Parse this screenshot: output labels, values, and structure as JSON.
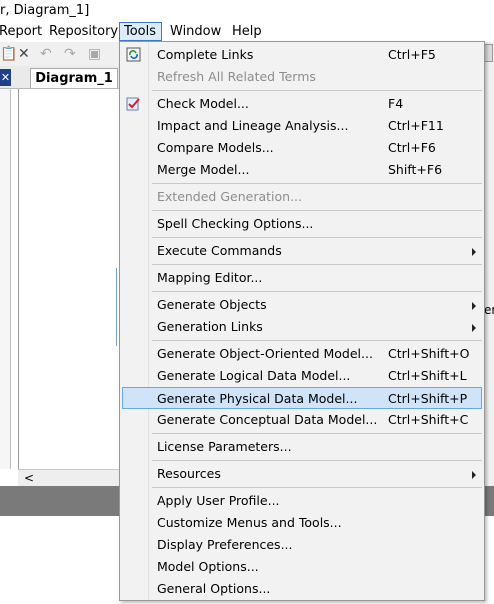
{
  "window": {
    "title_fragment": "r, Diagram_1]"
  },
  "menubar": {
    "report": "Report",
    "repository": "Repository",
    "tools": "Tools",
    "window": "Window",
    "help": "Help"
  },
  "document_tab": {
    "label": "Diagram_1"
  },
  "right_edge_text": "er",
  "tools_menu": {
    "complete_links": {
      "label": "Complete Links",
      "shortcut": "Ctrl+F5"
    },
    "refresh_terms": {
      "label": "Refresh All Related Terms",
      "shortcut": ""
    },
    "check_model": {
      "label": "Check Model...",
      "shortcut": "F4"
    },
    "impact_lineage": {
      "label": "Impact and Lineage Analysis...",
      "shortcut": "Ctrl+F11"
    },
    "compare_models": {
      "label": "Compare Models...",
      "shortcut": "Ctrl+F6"
    },
    "merge_model": {
      "label": "Merge Model...",
      "shortcut": "Shift+F6"
    },
    "extended_generation": {
      "label": "Extended Generation...",
      "shortcut": ""
    },
    "spell_checking": {
      "label": "Spell Checking Options...",
      "shortcut": ""
    },
    "execute_commands": {
      "label": "Execute Commands",
      "shortcut": ""
    },
    "mapping_editor": {
      "label": "Mapping Editor...",
      "shortcut": ""
    },
    "generate_objects": {
      "label": "Generate Objects",
      "shortcut": ""
    },
    "generation_links": {
      "label": "Generation Links",
      "shortcut": ""
    },
    "gen_oom": {
      "label": "Generate Object-Oriented Model...",
      "shortcut": "Ctrl+Shift+O"
    },
    "gen_ldm": {
      "label": "Generate Logical Data Model...",
      "shortcut": "Ctrl+Shift+L"
    },
    "gen_pdm": {
      "label": "Generate Physical Data Model...",
      "shortcut": "Ctrl+Shift+P"
    },
    "gen_cdm": {
      "label": "Generate Conceptual Data Model...",
      "shortcut": "Ctrl+Shift+C"
    },
    "license_params": {
      "label": "License Parameters...",
      "shortcut": ""
    },
    "resources": {
      "label": "Resources",
      "shortcut": ""
    },
    "apply_profile": {
      "label": "Apply User Profile...",
      "shortcut": ""
    },
    "customize_menus": {
      "label": "Customize Menus and Tools...",
      "shortcut": ""
    },
    "display_prefs": {
      "label": "Display Preferences...",
      "shortcut": ""
    },
    "model_options": {
      "label": "Model Options...",
      "shortcut": ""
    },
    "general_options": {
      "label": "General Options...",
      "shortcut": ""
    }
  },
  "colors": {
    "highlight": "#cfe4f9",
    "highlight_border": "#66a7e8",
    "menu_bg": "#f2f2f2",
    "disabled_text": "#8d8d8d"
  }
}
